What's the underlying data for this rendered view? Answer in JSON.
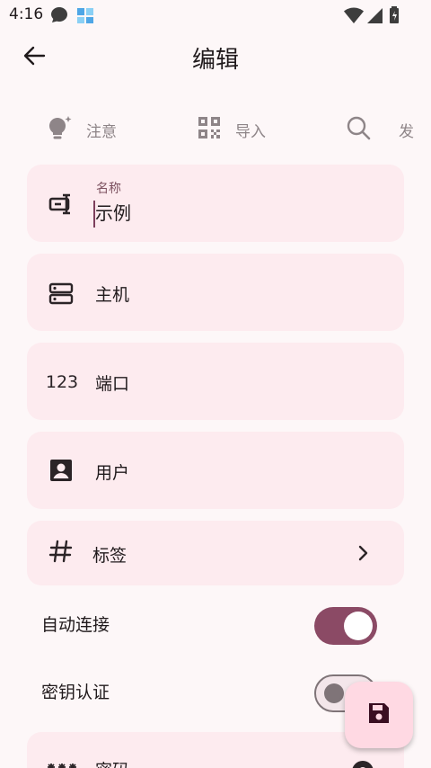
{
  "status_bar": {
    "time": "4:16"
  },
  "app_bar": {
    "title": "编辑"
  },
  "chips": [
    {
      "label": "注意",
      "icon": "lightbulb-sparkle-icon"
    },
    {
      "label": "导入",
      "icon": "qr-code-icon"
    },
    {
      "label": "发",
      "icon": "search-icon"
    }
  ],
  "fields": {
    "name": {
      "caption": "名称",
      "value": "示例"
    },
    "host": {
      "label": "主机"
    },
    "port": {
      "icon_text": "123",
      "label": "端口"
    },
    "user": {
      "label": "用户"
    },
    "tags": {
      "label": "标签"
    }
  },
  "toggles": [
    {
      "label": "自动连接",
      "checked": true
    },
    {
      "label": "密钥认证",
      "checked": false
    }
  ],
  "partial_field": {
    "label": "密码"
  },
  "colors": {
    "accent": "#8b4a65",
    "card": "#fdebef",
    "background": "#fdf7f8",
    "fab": "#ffd9e3"
  }
}
